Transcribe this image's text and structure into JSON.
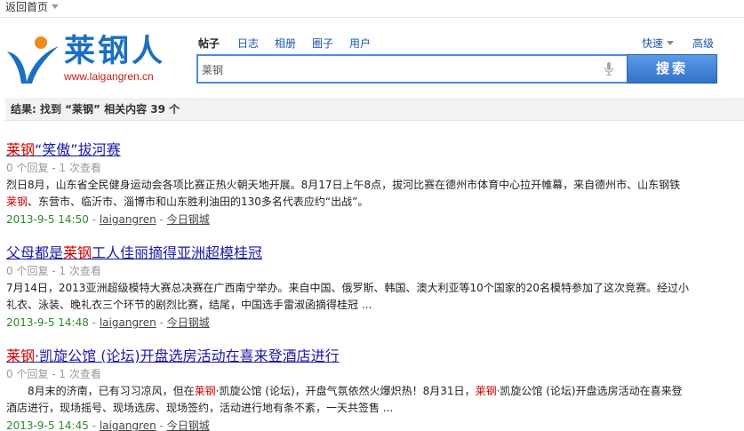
{
  "topbar": {
    "back_label": "返回首页"
  },
  "logo": {
    "name": "莱钢人",
    "url": "www.laigangren.cn"
  },
  "tabs": [
    {
      "label": "帖子",
      "active": true
    },
    {
      "label": "日志",
      "active": false
    },
    {
      "label": "相册",
      "active": false
    },
    {
      "label": "圈子",
      "active": false
    },
    {
      "label": "用户",
      "active": false
    }
  ],
  "search": {
    "value": "莱钢",
    "button_label": "搜索",
    "quick_label": "快速",
    "advanced_label": "高级"
  },
  "summary": {
    "prefix": "结果: 找到 “莱钢” 相关内容 39 个"
  },
  "results": [
    {
      "title_hl": "莱钢",
      "title_rest": "“笑傲”拔河赛",
      "meta": "0 个回复 - 1 次查看",
      "snippet": [
        {
          "text": "烈日8月，山东省全民健身运动会各项比赛正热火朝天地开展。8月17日上午8点，拔河比赛在德州市体育中心拉开帷幕，来自德州市、山东钢铁",
          "hl": false
        },
        {
          "text": "莱钢",
          "hl": true
        },
        {
          "text": "、东营市、临沂市、淄博市和山东胜利油田的130多名代表应约“出战”。",
          "hl": false
        }
      ],
      "date": "2013-9-5 14:50",
      "user": "laigangren",
      "forum": "今日钢城"
    },
    {
      "title_pre": "父母都是",
      "title_hl": "莱钢",
      "title_rest": "工人佳丽摘得亚洲超模桂冠",
      "meta": "0 个回复 - 1 次查看",
      "snippet": [
        {
          "text": "7月14日，2013亚洲超级模特大赛总决赛在广西南宁举办。来自中国、俄罗斯、韩国、澳大利亚等10个国家的20名模特参加了这次竞赛。经过小礼衣、泳装、晚礼衣三个环节的剧烈比赛，结尾，中国选手雷淑函摘得桂冠 ...",
          "hl": false
        }
      ],
      "date": "2013-9-5 14:48",
      "user": "laigangren",
      "forum": "今日钢城"
    },
    {
      "title_hl": "莱钢",
      "title_rest": "·凯旋公馆 (论坛)开盘选房活动在喜来登酒店进行",
      "meta": "0 个回复 - 1 次查看",
      "snippet": [
        {
          "text": "　　8月末的济南，已有习习凉风，但在",
          "hl": false
        },
        {
          "text": "莱钢",
          "hl": true
        },
        {
          "text": "·凯旋公馆 (论坛)，开盘气氛依然火爆炽热！8月31日，",
          "hl": false
        },
        {
          "text": "莱钢",
          "hl": true
        },
        {
          "text": "·凯旋公馆 (论坛)开盘选房活动在喜来登酒店进行，现场摇号、现场选房、现场签约，活动进行地有条不紊，一天共签售 ...",
          "hl": false
        }
      ],
      "date": "2013-9-5 14:45",
      "user": "laigangren",
      "forum": "今日钢城"
    }
  ],
  "colors": {
    "accent": "#1a6fc2",
    "highlight": "#cc0000",
    "link": "#1a1aa6",
    "date": "#2a8a2a"
  }
}
